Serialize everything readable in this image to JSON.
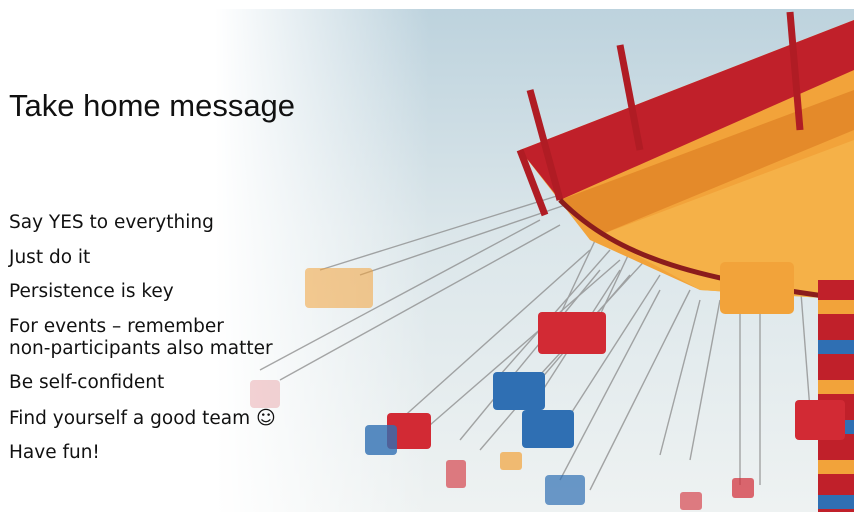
{
  "slide": {
    "title": "Take home message",
    "bullets": [
      {
        "text": "Say YES to everything"
      },
      {
        "text": "Just do it"
      },
      {
        "text": "Persistence is key"
      },
      {
        "line1": "For events – remember",
        "line2": "non-participants also matter"
      },
      {
        "text": "Be self-confident"
      },
      {
        "text": "Find yourself a good team",
        "emoji": "☺"
      },
      {
        "text": "Have fun!"
      }
    ]
  },
  "photo": {
    "subject": "swing-carousel-image",
    "colors": {
      "canopy_orange": "#f2a33a",
      "canopy_red": "#c0202a",
      "sky": "#d6e2e7",
      "seat_blue": "#2f6fb3"
    }
  }
}
